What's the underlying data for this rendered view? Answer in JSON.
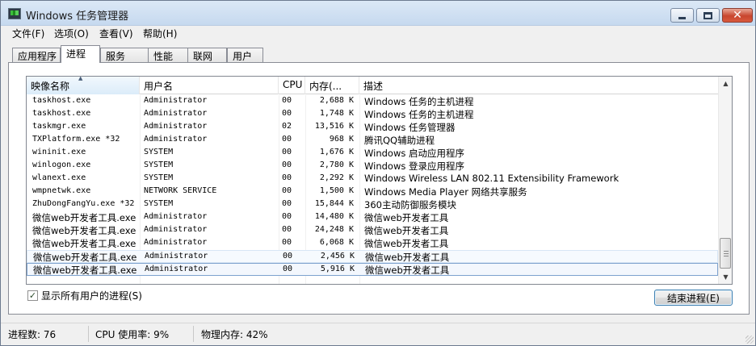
{
  "window": {
    "title": "Windows 任务管理器"
  },
  "menu": [
    "文件(F)",
    "选项(O)",
    "查看(V)",
    "帮助(H)"
  ],
  "tabs": [
    {
      "label": "应用程序"
    },
    {
      "label": "进程",
      "active": true
    },
    {
      "label": "服务"
    },
    {
      "label": "性能"
    },
    {
      "label": "联网"
    },
    {
      "label": "用户"
    }
  ],
  "columns": {
    "name": "映像名称",
    "user": "用户名",
    "cpu": "CPU",
    "mem": "内存(...",
    "desc": "描述"
  },
  "rows": [
    {
      "name": "taskhost.exe",
      "user": "Administrator",
      "cpu": "00",
      "mem": "2,688 K",
      "desc": "Windows 任务的主机进程"
    },
    {
      "name": "taskhost.exe",
      "user": "Administrator",
      "cpu": "00",
      "mem": "1,748 K",
      "desc": "Windows 任务的主机进程"
    },
    {
      "name": "taskmgr.exe",
      "user": "Administrator",
      "cpu": "02",
      "mem": "13,516 K",
      "desc": "Windows 任务管理器"
    },
    {
      "name": "TXPlatform.exe *32",
      "user": "Administrator",
      "cpu": "00",
      "mem": "968 K",
      "desc": "腾讯QQ辅助进程"
    },
    {
      "name": "wininit.exe",
      "user": "SYSTEM",
      "cpu": "00",
      "mem": "1,676 K",
      "desc": "Windows 启动应用程序"
    },
    {
      "name": "winlogon.exe",
      "user": "SYSTEM",
      "cpu": "00",
      "mem": "2,780 K",
      "desc": "Windows 登录应用程序"
    },
    {
      "name": "wlanext.exe",
      "user": "SYSTEM",
      "cpu": "00",
      "mem": "2,292 K",
      "desc": "Windows Wireless LAN 802.11 Extensibility Framework"
    },
    {
      "name": "wmpnetwk.exe",
      "user": "NETWORK SERVICE",
      "cpu": "00",
      "mem": "1,500 K",
      "desc": "Windows Media Player 网络共享服务"
    },
    {
      "name": "ZhuDongFangYu.exe *32",
      "user": "SYSTEM",
      "cpu": "00",
      "mem": "15,844 K",
      "desc": "360主动防御服务模块"
    },
    {
      "name": "微信web开发者工具.exe",
      "user": "Administrator",
      "cpu": "00",
      "mem": "14,480 K",
      "desc": "微信web开发者工具"
    },
    {
      "name": "微信web开发者工具.exe",
      "user": "Administrator",
      "cpu": "00",
      "mem": "24,248 K",
      "desc": "微信web开发者工具"
    },
    {
      "name": "微信web开发者工具.exe",
      "user": "Administrator",
      "cpu": "00",
      "mem": "6,068 K",
      "desc": "微信web开发者工具"
    },
    {
      "name": "微信web开发者工具.exe",
      "user": "Administrator",
      "cpu": "00",
      "mem": "2,456 K",
      "desc": "微信web开发者工具",
      "state": "hover"
    },
    {
      "name": "微信web开发者工具.exe",
      "user": "Administrator",
      "cpu": "00",
      "mem": "5,916 K",
      "desc": "微信web开发者工具",
      "state": "selected"
    }
  ],
  "show_all_users": {
    "label": "显示所有用户的进程(S)",
    "checked": true
  },
  "end_process_button": "结束进程(E)",
  "status": {
    "processes": "进程数: 76",
    "cpu": "CPU 使用率: 9%",
    "memory": "物理内存: 42%"
  },
  "colors": {
    "selected_border": "#7da2ce",
    "button_border": "#3c7fb1"
  }
}
